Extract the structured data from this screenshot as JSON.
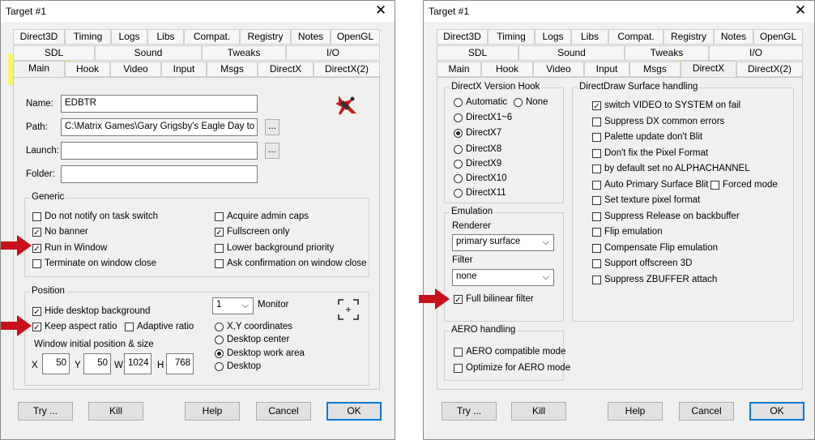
{
  "left": {
    "title": "Target #1",
    "close": "✕",
    "tabs_row1": [
      "Direct3D",
      "Timing",
      "Logs",
      "Libs",
      "Compat.",
      "Registry",
      "Notes",
      "OpenGL"
    ],
    "tabs_row2": [
      "SDL",
      "Sound",
      "Tweaks",
      "I/O"
    ],
    "tabs_row3": [
      "Main",
      "Hook",
      "Video",
      "Input",
      "Msgs",
      "DirectX",
      "DirectX(2)"
    ],
    "name_label": "Name:",
    "name_value": "EDBTR",
    "path_label": "Path:",
    "path_value": "C:\\Matrix Games\\Gary Grigsby's Eagle Day to the",
    "launch_label": "Launch:",
    "launch_value": "",
    "folder_label": "Folder:",
    "folder_value": "",
    "dots": "...",
    "generic_title": "Generic",
    "generic": [
      {
        "label": "Do not notify on task switch",
        "checked": false
      },
      {
        "label": "No banner",
        "checked": true
      },
      {
        "label": "Run in Window",
        "checked": true
      },
      {
        "label": "Terminate on window close",
        "checked": false
      },
      {
        "label": "Acquire admin caps",
        "checked": false
      },
      {
        "label": "Fullscreen only",
        "checked": true
      },
      {
        "label": "Lower background priority",
        "checked": false
      },
      {
        "label": "Ask confirmation on window close",
        "checked": false
      }
    ],
    "position_title": "Position",
    "hide_desktop": "Hide desktop background",
    "keep_aspect": "Keep aspect ratio",
    "adaptive": "Adaptive ratio",
    "monitor_value": "1",
    "monitor_label": "Monitor",
    "coord_modes": [
      {
        "label": "X,Y coordinates",
        "selected": false
      },
      {
        "label": "Desktop center",
        "selected": false
      },
      {
        "label": "Desktop work area",
        "selected": true
      },
      {
        "label": "Desktop",
        "selected": false
      }
    ],
    "winpos_label": "Window initial position & size",
    "x_label": "X",
    "x_value": "50",
    "y_label": "Y",
    "y_value": "50",
    "w_label": "W",
    "w_value": "1024",
    "h_label": "H",
    "h_value": "768",
    "buttons": {
      "try": "Try ...",
      "kill": "Kill",
      "help": "Help",
      "cancel": "Cancel",
      "ok": "OK"
    }
  },
  "right": {
    "title": "Target #1",
    "close": "✕",
    "tabs_row1": [
      "Direct3D",
      "Timing",
      "Logs",
      "Libs",
      "Compat.",
      "Registry",
      "Notes",
      "OpenGL"
    ],
    "tabs_row2": [
      "SDL",
      "Sound",
      "Tweaks",
      "I/O"
    ],
    "tabs_row3": [
      "Main",
      "Hook",
      "Video",
      "Input",
      "Msgs",
      "DirectX",
      "DirectX(2)"
    ],
    "dx_hook_title": "DirectX Version Hook",
    "dx_hook": [
      {
        "label": "Automatic",
        "selected": false
      },
      {
        "label": "None",
        "selected": false
      },
      {
        "label": "DirectX1~6",
        "selected": false
      },
      {
        "label": "DirectX7",
        "selected": true
      },
      {
        "label": "DirectX8",
        "selected": false
      },
      {
        "label": "DirectX9",
        "selected": false
      },
      {
        "label": "DirectX10",
        "selected": false
      },
      {
        "label": "DirectX11",
        "selected": false
      }
    ],
    "emulation_title": "Emulation",
    "renderer_label": "Renderer",
    "renderer_value": "primary surface",
    "filter_label": "Filter",
    "filter_value": "none",
    "bilinear": "Full bilinear filter",
    "aero_title": "AERO handling",
    "aero": [
      {
        "label": "AERO compatible mode",
        "checked": false
      },
      {
        "label": "Optimize for AERO mode",
        "checked": false
      }
    ],
    "dd_title": "DirectDraw Surface handling",
    "dd": [
      {
        "label": "switch VIDEO to SYSTEM on fail",
        "checked": true
      },
      {
        "label": "Suppress DX common errors",
        "checked": false
      },
      {
        "label": "Palette update don't Blit",
        "checked": false
      },
      {
        "label": "Don't fix the Pixel Format",
        "checked": false
      },
      {
        "label": "by default set no ALPHACHANNEL",
        "checked": false
      },
      {
        "label": "Auto Primary Surface Blit",
        "checked": false
      },
      {
        "label": "Forced mode",
        "checked": false
      },
      {
        "label": "Set texture pixel format",
        "checked": false
      },
      {
        "label": "Suppress Release on backbuffer",
        "checked": false
      },
      {
        "label": "Flip emulation",
        "checked": false
      },
      {
        "label": "Compensate Flip emulation",
        "checked": false
      },
      {
        "label": "Support offscreen 3D",
        "checked": false
      },
      {
        "label": "Suppress ZBUFFER attach",
        "checked": false
      }
    ],
    "buttons": {
      "try": "Try ...",
      "kill": "Kill",
      "help": "Help",
      "cancel": "Cancel",
      "ok": "OK"
    }
  },
  "colors": {
    "highlight": "#f9f56a",
    "arrow": "#c8101a",
    "accent": "#0078d7"
  },
  "icons": {
    "app": "airplane-icon",
    "monitor": "fullscreen-corners-icon",
    "arrow": "red-arrow-icon"
  }
}
